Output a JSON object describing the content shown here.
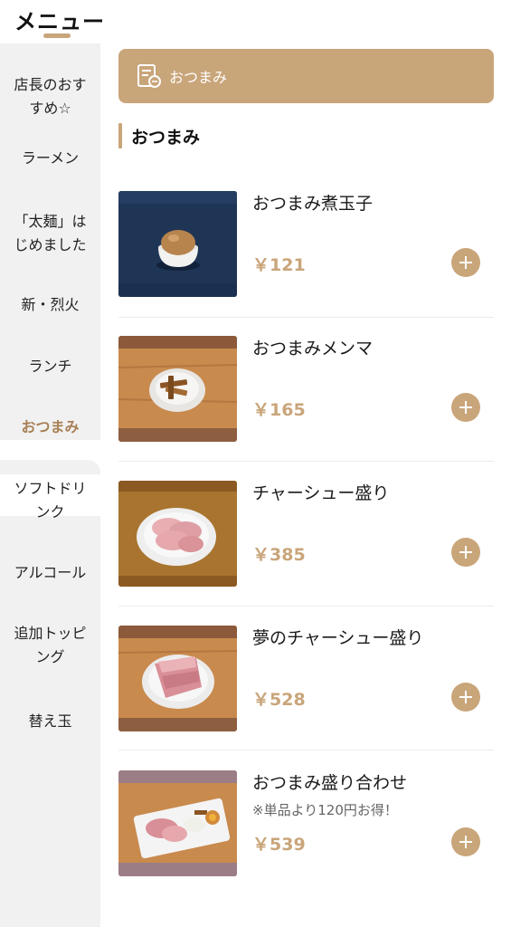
{
  "header": {
    "title": "メニュー"
  },
  "sidebar": {
    "items": [
      {
        "label": "店長のおすすめ☆"
      },
      {
        "label": "ラーメン"
      },
      {
        "label": "「太麺」はじめました"
      },
      {
        "label": "新・烈火"
      },
      {
        "label": "ランチ"
      },
      {
        "label": "おつまみ",
        "active": true
      },
      {
        "label": "ソフトドリンク"
      },
      {
        "label": "アルコール"
      },
      {
        "label": "追加トッピング"
      },
      {
        "label": "替え玉"
      }
    ]
  },
  "banner": {
    "label": "おつまみ",
    "icon": "menu-list-icon"
  },
  "section": {
    "title": "おつまみ"
  },
  "items": [
    {
      "name": "おつまみ煮玉子",
      "note": "",
      "price": "￥121",
      "image": "boiled-egg-photo"
    },
    {
      "name": "おつまみメンマ",
      "note": "",
      "price": "￥165",
      "image": "menma-photo"
    },
    {
      "name": "チャーシュー盛り",
      "note": "",
      "price": "￥385",
      "image": "chashu-plate-photo"
    },
    {
      "name": "夢のチャーシュー盛り",
      "note": "",
      "price": "￥528",
      "image": "big-chashu-plate-photo"
    },
    {
      "name": "おつまみ盛り合わせ",
      "note": "※単品より120円お得！",
      "price": "￥539",
      "image": "assorted-plate-photo"
    }
  ],
  "colors": {
    "accent": "#c9a57a",
    "sidebar_bg": "#f1f1f1"
  }
}
